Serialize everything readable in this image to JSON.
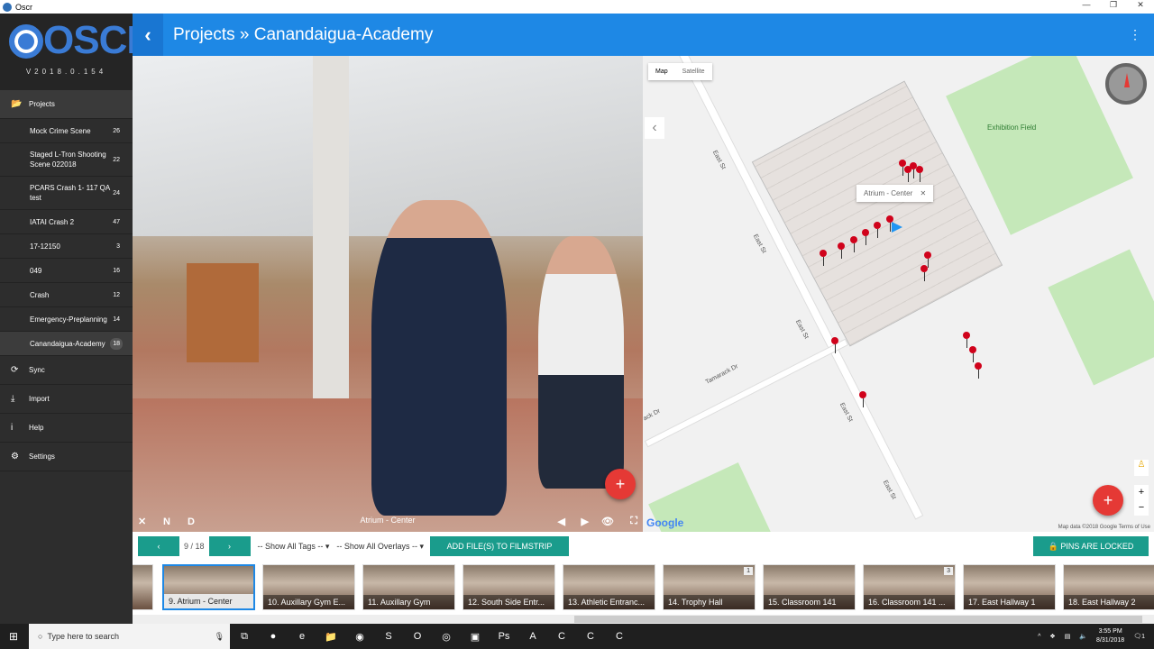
{
  "window": {
    "title": "Oscr",
    "controls": [
      "—",
      "❐",
      "✕"
    ]
  },
  "sidebar": {
    "logo": "OSCR",
    "version": "V2018.0.154",
    "projects_label": "Projects",
    "projects": [
      {
        "name": "Mock Crime Scene",
        "count": "26"
      },
      {
        "name": "Staged L-Tron Shooting Scene 022018",
        "count": "22"
      },
      {
        "name": "PCARS Crash 1- 117 QA test",
        "count": "24"
      },
      {
        "name": "IATAI Crash 2",
        "count": "47"
      },
      {
        "name": "17-12150",
        "count": "3"
      },
      {
        "name": "049",
        "count": "16"
      },
      {
        "name": "Crash",
        "count": "12"
      },
      {
        "name": "Emergency-Preplanning",
        "count": "14"
      },
      {
        "name": "Canandaigua-Academy",
        "count": "18",
        "selected": true
      }
    ],
    "menu": [
      {
        "label": "Sync",
        "icon": "sync-icon"
      },
      {
        "label": "Import",
        "icon": "import-icon"
      },
      {
        "label": "Help",
        "icon": "info-icon"
      },
      {
        "label": "Settings",
        "icon": "gear-icon"
      }
    ]
  },
  "header": {
    "title": "Projects » Canandaigua-Academy",
    "color": "#1e88e5"
  },
  "viewer": {
    "caption": "Atrium - Center",
    "buttons": [
      "✕",
      "N",
      "D"
    ]
  },
  "map": {
    "type_map": "Map",
    "type_satellite": "Satellite",
    "popup": "Atrium - Center",
    "poi": "Exhibition Field",
    "streets": [
      "East St",
      "East St",
      "East St",
      "East St",
      "East St",
      "Tamarack Dr",
      "ack Dr"
    ],
    "attribution": "Map data ©2018 Google",
    "terms": "Terms of Use",
    "google": "Google"
  },
  "toolbar": {
    "counter": "9 / 18",
    "tags": "-- Show All Tags --",
    "overlays": "-- Show All Overlays --",
    "add_files": "ADD FILE(S) TO FILMSTRIP",
    "pins_locked": "PINS ARE LOCKED",
    "accent": "#1a9c8c"
  },
  "filmstrip": [
    {
      "label": "",
      "active": false
    },
    {
      "label": "9. Atrium - Center",
      "active": true
    },
    {
      "label": "10. Auxillary Gym E..."
    },
    {
      "label": "11. Auxillary Gym"
    },
    {
      "label": "12. South Side Entr..."
    },
    {
      "label": "13. Athletic Entranc..."
    },
    {
      "label": "14. Trophy Hall",
      "badge": "1"
    },
    {
      "label": "15. Classroom 141"
    },
    {
      "label": "16. Classroom 141 ...",
      "badge": "3"
    },
    {
      "label": "17. East Hallway 1"
    },
    {
      "label": "18. East Hallway 2"
    }
  ],
  "taskbar": {
    "search": "Type here to search",
    "time": "3:55 PM",
    "date": "8/31/2018",
    "notifications": "1"
  }
}
